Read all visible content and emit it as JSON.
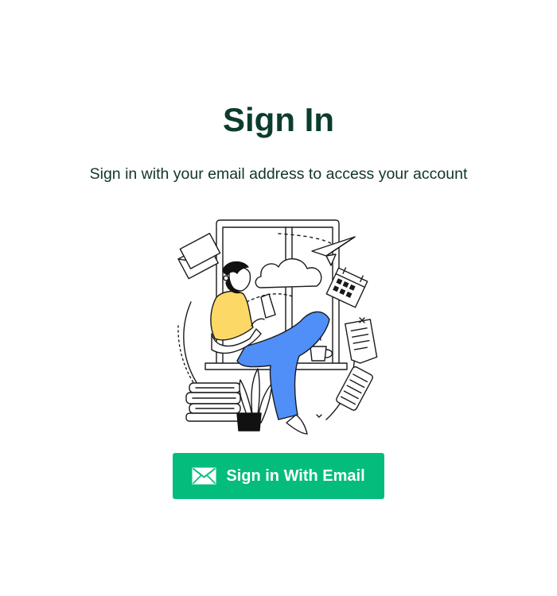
{
  "page": {
    "title": "Sign In",
    "subtitle": "Sign in with your email address to access your account"
  },
  "illustration": {
    "subject": "person-reading-phone-by-window-illustration"
  },
  "signin_button": {
    "label": "Sign in With Email",
    "icon": "envelope-icon"
  },
  "colors": {
    "title": "#0b3d2e",
    "subtitle": "#12352c",
    "button_bg": "#04bd7d",
    "button_text": "#ffffff",
    "accent_blue": "#4f8ff7",
    "accent_yellow": "#fcd966"
  }
}
